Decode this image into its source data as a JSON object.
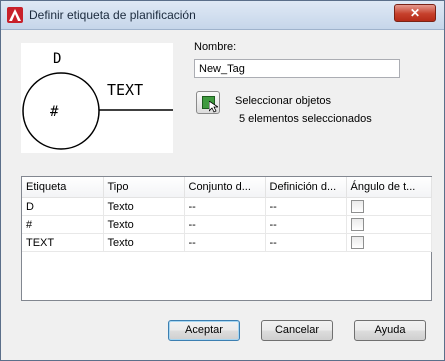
{
  "window": {
    "title": "Definir etiqueta de planificación",
    "close_label": "✕"
  },
  "preview": {
    "tag_top": "D",
    "tag_center": "#",
    "tag_right": "TEXT"
  },
  "name": {
    "label": "Nombre:",
    "value": "New_Tag"
  },
  "select_objects": {
    "label": "Seleccionar objetos",
    "count_text": "5 elementos seleccionados"
  },
  "table": {
    "columns": [
      "Etiqueta",
      "Tipo",
      "Conjunto d...",
      "Definición d...",
      "Ángulo de t..."
    ],
    "rows": [
      [
        "D",
        "Texto",
        "--",
        "--"
      ],
      [
        "#",
        "Texto",
        "--",
        "--"
      ],
      [
        "TEXT",
        "Texto",
        "--",
        "--"
      ]
    ]
  },
  "buttons": {
    "accept": "Aceptar",
    "cancel": "Cancelar",
    "help": "Ayuda"
  }
}
